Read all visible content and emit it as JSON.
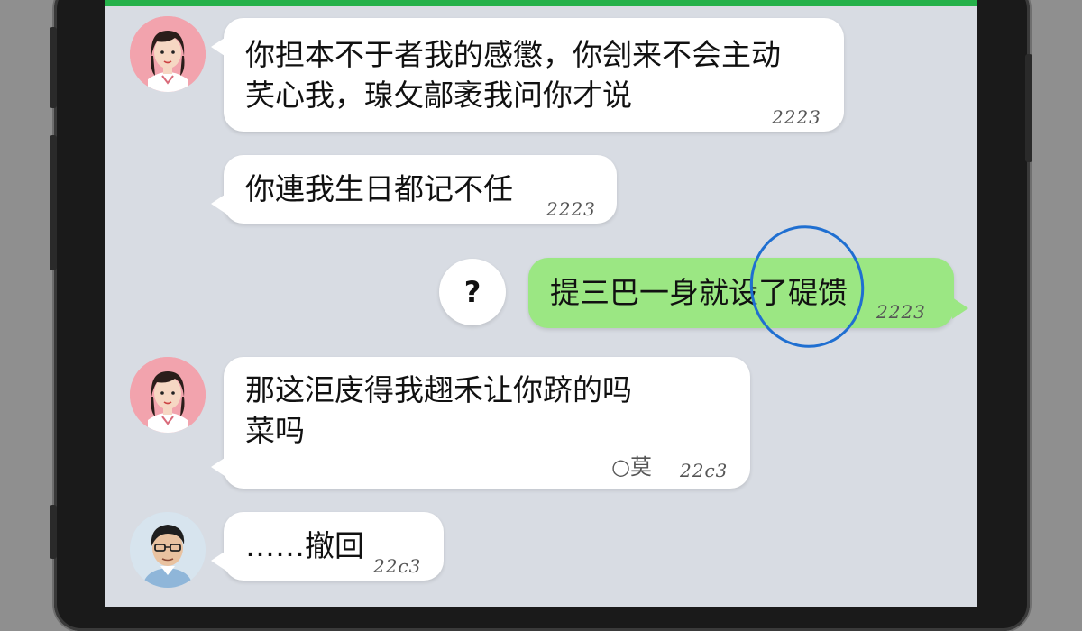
{
  "chat": {
    "messages": [
      {
        "sender": "her",
        "lines": [
          "你担本不于者我的感懲，你刽来不会主动",
          "芺心我，瑔攵鄗袤我问你才说"
        ],
        "time": "2223"
      },
      {
        "sender": "her",
        "lines": [
          "你連我生日都记不任"
        ],
        "time": "2223"
      },
      {
        "sender": "me",
        "lines": [
          "提三巴一身就设了碮馈"
        ],
        "time": "2223",
        "reaction": "?"
      },
      {
        "sender": "her",
        "lines": [
          "那这洰庋得我趐禾让你跻的吗",
          "菜吗"
        ],
        "read": "○莫",
        "time": "22c3"
      },
      {
        "sender": "him",
        "lines": [
          "……撤回"
        ],
        "time": "22c3"
      }
    ]
  },
  "colors": {
    "top_bar": "#25b14a",
    "chat_bg": "#d8dce3",
    "my_bubble": "#9be783",
    "their_bubble": "#ffffff",
    "annotation_circle": "#1f6fd1"
  }
}
